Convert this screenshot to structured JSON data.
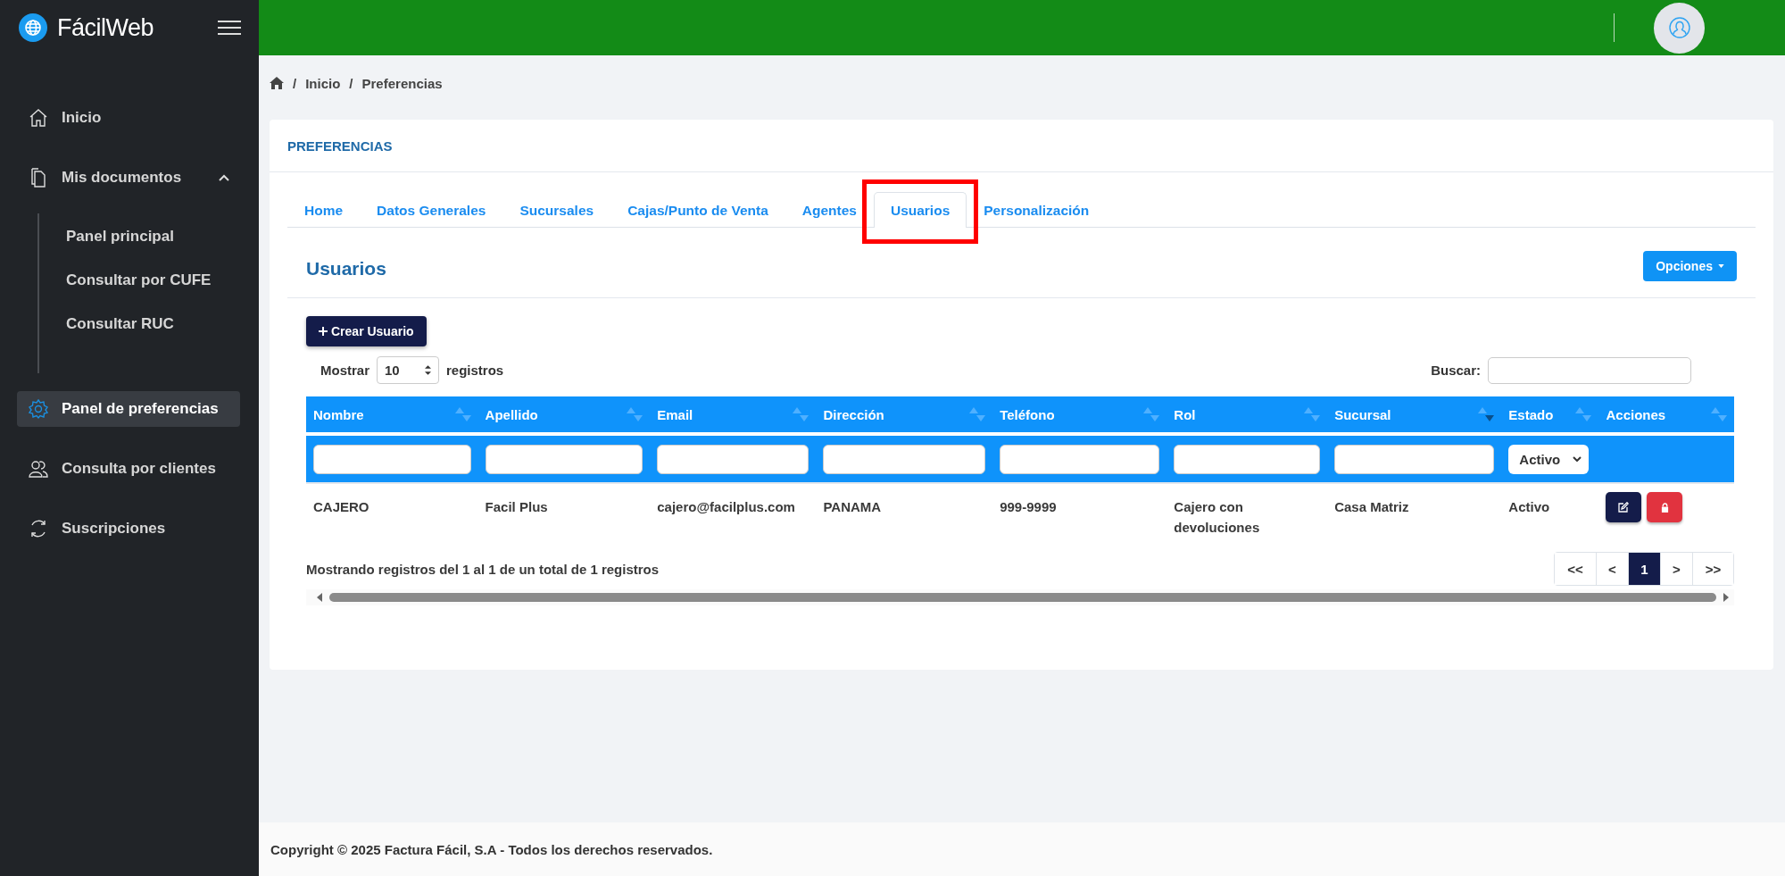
{
  "brand": {
    "name": "FácilWeb"
  },
  "sidebar": {
    "items": [
      {
        "label": "Inicio",
        "kind": "link",
        "selected": false
      },
      {
        "label": "Mis documentos",
        "kind": "group",
        "selected": false,
        "expanded": true,
        "children": [
          {
            "label": "Panel principal",
            "selected": false
          },
          {
            "label": "Consultar por CUFE",
            "selected": false
          },
          {
            "label": "Consultar RUC",
            "selected": false
          }
        ]
      },
      {
        "label": "Panel de preferencias",
        "kind": "link",
        "selected": true
      },
      {
        "label": "Consulta por clientes",
        "kind": "link",
        "selected": false
      },
      {
        "label": "Suscripciones",
        "kind": "link",
        "selected": false
      }
    ]
  },
  "breadcrumb": {
    "separator": "/",
    "items": [
      "Inicio",
      "Preferencias"
    ]
  },
  "card": {
    "title": "PREFERENCIAS"
  },
  "tabs": [
    {
      "label": "Home",
      "selected": false,
      "highlighted": false
    },
    {
      "label": "Datos Generales",
      "selected": false,
      "highlighted": false
    },
    {
      "label": "Sucursales",
      "selected": false,
      "highlighted": false
    },
    {
      "label": "Cajas/Punto de Venta",
      "selected": false,
      "highlighted": false
    },
    {
      "label": "Agentes",
      "selected": false,
      "highlighted": false
    },
    {
      "label": "Usuarios",
      "selected": true,
      "highlighted": true
    },
    {
      "label": "Personalización",
      "selected": false,
      "highlighted": false
    }
  ],
  "section": {
    "title": "Usuarios",
    "options_button": "Opciones",
    "create_button": "Crear Usuario"
  },
  "length": {
    "label": "Mostrar",
    "value": "10",
    "suffix": "registros"
  },
  "search": {
    "label": "Buscar:"
  },
  "table": {
    "columns": [
      {
        "label": "Nombre",
        "sorted_descending": false
      },
      {
        "label": "Apellido",
        "sorted_descending": false
      },
      {
        "label": "Email",
        "sorted_descending": false
      },
      {
        "label": "Dirección",
        "sorted_descending": false
      },
      {
        "label": "Teléfono",
        "sorted_descending": false
      },
      {
        "label": "Rol",
        "sorted_descending": false
      },
      {
        "label": "Sucursal",
        "sorted_descending": true
      },
      {
        "label": "Estado",
        "sorted_descending": false
      },
      {
        "label": "Acciones",
        "sorted_descending": false
      }
    ],
    "filters": [
      {
        "kind": "text"
      },
      {
        "kind": "text"
      },
      {
        "kind": "text"
      },
      {
        "kind": "text"
      },
      {
        "kind": "text"
      },
      {
        "kind": "text"
      },
      {
        "kind": "text"
      },
      {
        "kind": "select",
        "value": "Activo"
      },
      {
        "kind": "blank"
      }
    ],
    "rows": [
      {
        "cells": [
          "CAJERO",
          "Facil Plus",
          "cajero@facilplus.com",
          "PANAMA",
          "999-9999",
          "Cajero con devoluciones",
          "Casa Matriz",
          "Activo"
        ]
      }
    ]
  },
  "info": "Mostrando registros del 1 al 1 de un total de 1 registros",
  "pagination": [
    {
      "label": "<<",
      "selected": false
    },
    {
      "label": "<",
      "selected": false
    },
    {
      "label": "1",
      "selected": true
    },
    {
      "label": ">",
      "selected": false
    },
    {
      "label": ">>",
      "selected": false
    }
  ],
  "footer": "Copyright © 2025 Factura Fácil, S.A - Todos los derechos reservados."
}
